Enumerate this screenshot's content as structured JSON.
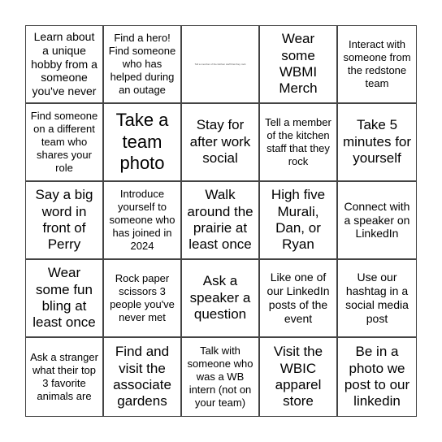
{
  "card": {
    "cells": [
      {
        "text": "Learn about a unique hobby from a someone you've never",
        "size": "s-md"
      },
      {
        "text": "Find a hero! Find someone who has helped during an outage",
        "size": "s-sm"
      },
      {
        "text": "Tell a member of the kitchen staff that they rock",
        "size": "s-xs"
      },
      {
        "text": "Wear some WBMI Merch",
        "size": "s-lg"
      },
      {
        "text": "Interact with someone from the redstone team",
        "size": "s-sm"
      },
      {
        "text": "Find someone on a different team who shares your role",
        "size": "s-sm"
      },
      {
        "text": "Take a team photo",
        "size": "s-xl"
      },
      {
        "text": "Stay for after work social",
        "size": "s-lg"
      },
      {
        "text": "Tell a member of the kitchen staff that they rock",
        "size": "s-sm"
      },
      {
        "text": "Take 5 minutes for yourself",
        "size": "s-lg"
      },
      {
        "text": "Say a big word in front of Perry",
        "size": "s-lg"
      },
      {
        "text": "Introduce yourself to someone who has joined in 2024",
        "size": "s-sm"
      },
      {
        "text": "Walk around the prairie at least once",
        "size": "s-lg"
      },
      {
        "text": "High five Murali, Dan, or Ryan",
        "size": "s-lg"
      },
      {
        "text": "Connect with a speaker on LinkedIn",
        "size": "s-md"
      },
      {
        "text": "Wear some fun bling at least once",
        "size": "s-lg"
      },
      {
        "text": "Rock paper scissors 3 people you've never met",
        "size": "s-sm"
      },
      {
        "text": "Ask a speaker a question",
        "size": "s-lg"
      },
      {
        "text": "Like one of our LinkedIn posts of the event",
        "size": "s-md"
      },
      {
        "text": "Use our hashtag in a social media post",
        "size": "s-md"
      },
      {
        "text": "Ask a stranger what their top 3 favorite animals are",
        "size": "s-sm"
      },
      {
        "text": "Find and visit the associate gardens",
        "size": "s-lg"
      },
      {
        "text": "Talk with someone who was a WB intern (not on your team)",
        "size": "s-sm"
      },
      {
        "text": "Visit the WBIC apparel store",
        "size": "s-lg"
      },
      {
        "text": "Be in a photo we post to our linkedin",
        "size": "s-lg"
      }
    ]
  }
}
